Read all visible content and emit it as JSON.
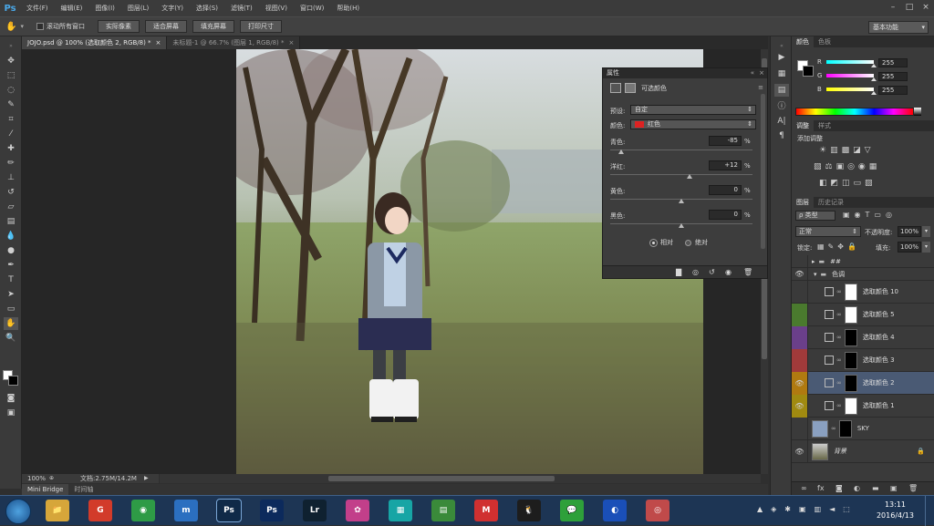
{
  "app": {
    "logo": "Ps"
  },
  "menu": [
    "文件(F)",
    "编辑(E)",
    "图像(I)",
    "图层(L)",
    "文字(Y)",
    "选择(S)",
    "滤镜(T)",
    "视图(V)",
    "窗口(W)",
    "帮助(H)"
  ],
  "options": {
    "scroll_all_label": "滚动所有窗口",
    "buttons": [
      "实际像素",
      "适合屏幕",
      "填充屏幕",
      "打印尺寸"
    ],
    "workspace": "基本功能"
  },
  "doc_tabs": [
    {
      "label": "JOJO.psd @ 100% (选取颜色 2, RGB/8) *",
      "close": "×"
    },
    {
      "label": "未标题-1 @ 66.7% (图层 1, RGB/8) *",
      "close": "×"
    }
  ],
  "status": {
    "zoom": "100%",
    "doc": "文档:2.75M/14.2M",
    "arrow": "▶"
  },
  "bridge_tabs": [
    "Mini Bridge",
    "时间轴"
  ],
  "color_panel": {
    "tabs": [
      "颜色",
      "色板"
    ],
    "channels": [
      {
        "label": "R",
        "value": "255",
        "gradient_from": "#00ffff",
        "gradient_to": "#ffffff"
      },
      {
        "label": "G",
        "value": "255",
        "gradient_from": "#ff00ff",
        "gradient_to": "#ffffff"
      },
      {
        "label": "B",
        "value": "255",
        "gradient_from": "#ffff00",
        "gradient_to": "#ffffff"
      }
    ]
  },
  "adjust_panel": {
    "tabs": [
      "调整",
      "样式"
    ],
    "title": "添加调整"
  },
  "layers_panel": {
    "tabs": [
      "图层",
      "历史记录"
    ],
    "filter_kind": "ρ 类型",
    "blend_mode": "正常",
    "opacity_label": "不透明度:",
    "opacity_value": "100%",
    "lock_label": "锁定:",
    "fill_label": "填充:",
    "fill_value": "100%",
    "layers": [
      {
        "name": "##",
        "type": "group",
        "color": "none",
        "eye": ""
      },
      {
        "name": "色调",
        "type": "group-open",
        "color": "none",
        "eye": "👁"
      },
      {
        "name": "选取颜色 10",
        "type": "adj",
        "color": "none",
        "eye": "",
        "mask": "white"
      },
      {
        "name": "选取颜色 5",
        "type": "adj",
        "color": "#4a7a2e",
        "eye": "",
        "mask": "white"
      },
      {
        "name": "选取颜色 4",
        "type": "adj",
        "color": "#6a3f8a",
        "eye": "",
        "mask": "black"
      },
      {
        "name": "选取颜色 3",
        "type": "adj",
        "color": "#a03a3a",
        "eye": "",
        "mask": "black"
      },
      {
        "name": "选取颜色 2",
        "type": "adj",
        "color": "#b07a10",
        "eye": "👁",
        "mask": "black",
        "selected": true
      },
      {
        "name": "选取颜色 1",
        "type": "adj",
        "color": "#a08a10",
        "eye": "👁",
        "mask": "white"
      },
      {
        "name": "SKY",
        "type": "pixel",
        "color": "none",
        "eye": ""
      },
      {
        "name": "背景",
        "type": "background",
        "color": "none",
        "eye": "👁"
      }
    ]
  },
  "properties": {
    "tab": "属性",
    "title": "可选颜色",
    "preset_label": "预设:",
    "preset_value": "自定",
    "colors_label": "颜色:",
    "colors_value": "红色",
    "sliders": [
      {
        "label": "青色:",
        "value": "-85",
        "pct": "%",
        "level": -85
      },
      {
        "label": "洋红:",
        "value": "+12",
        "pct": "%",
        "level": 12
      },
      {
        "label": "黄色:",
        "value": "0",
        "pct": "%",
        "level": 0
      },
      {
        "label": "黑色:",
        "value": "0",
        "pct": "%",
        "level": 0
      }
    ],
    "relative": "相对",
    "absolute": "绝对"
  },
  "taskbar": {
    "apps": [
      "📁",
      "G",
      "◉",
      "m",
      "Ps",
      "Ps",
      "Lr",
      "✿",
      "▦",
      "▤",
      "M",
      "🐧",
      "💬",
      "◐",
      "◎"
    ],
    "time": "13:11",
    "date": "2016/4/13"
  },
  "colors": {
    "accent": "#4aa8e8",
    "panel_bg": "#3a3a3a",
    "selected_layer": "#4a5a74"
  }
}
